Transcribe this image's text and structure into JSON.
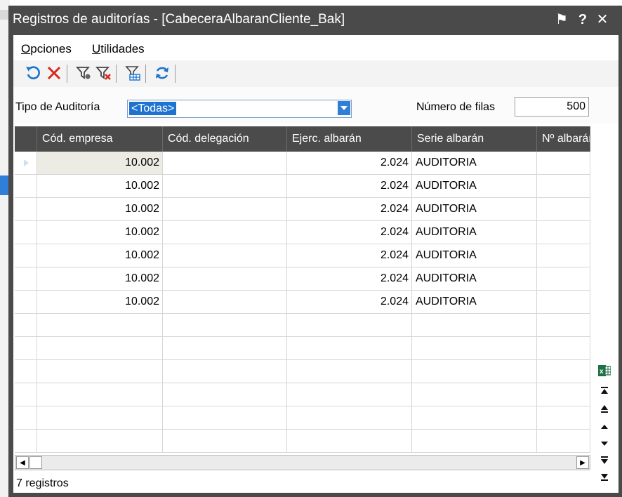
{
  "window": {
    "title": "Registros de auditorías - [CabeceraAlbaranCliente_Bak]",
    "pin_glyph": "⚑",
    "help_glyph": "?",
    "close_glyph": "✕"
  },
  "menu": {
    "items": [
      {
        "accel": "O",
        "rest": "pciones"
      },
      {
        "accel": "U",
        "rest": "tilidades"
      }
    ]
  },
  "toolbar": {
    "icons": [
      "undo-icon",
      "delete-icon",
      "filter-edit-icon",
      "filter-clear-icon",
      "filter-table-icon",
      "refresh-icon"
    ]
  },
  "filters": {
    "tipo_label": "Tipo de Auditoría",
    "tipo_value": "<Todas>",
    "filas_label": "Número de filas",
    "filas_value": "500"
  },
  "grid": {
    "columns": [
      "Cód. empresa",
      "Cód. delegación",
      "Ejerc. albarán",
      "Serie albarán",
      "Nº albarán"
    ],
    "rows": [
      {
        "empresa": "10.002",
        "delegacion": "",
        "ejercicio": "2.024",
        "serie": "AUDITORIA",
        "albaran": ""
      },
      {
        "empresa": "10.002",
        "delegacion": "",
        "ejercicio": "2.024",
        "serie": "AUDITORIA",
        "albaran": ""
      },
      {
        "empresa": "10.002",
        "delegacion": "",
        "ejercicio": "2.024",
        "serie": "AUDITORIA",
        "albaran": ""
      },
      {
        "empresa": "10.002",
        "delegacion": "",
        "ejercicio": "2.024",
        "serie": "AUDITORIA",
        "albaran": ""
      },
      {
        "empresa": "10.002",
        "delegacion": "",
        "ejercicio": "2.024",
        "serie": "AUDITORIA",
        "albaran": ""
      },
      {
        "empresa": "10.002",
        "delegacion": "",
        "ejercicio": "2.024",
        "serie": "AUDITORIA",
        "albaran": ""
      },
      {
        "empresa": "10.002",
        "delegacion": "",
        "ejercicio": "2.024",
        "serie": "AUDITORIA",
        "albaran": ""
      }
    ],
    "empty_rows": 6
  },
  "side_buttons": [
    "excel-export-icon",
    "first-record-icon",
    "previous-page-icon",
    "previous-record-icon",
    "next-record-icon",
    "next-page-icon",
    "last-record-icon"
  ],
  "status": "7 registros",
  "colors": {
    "title_bg": "#4a4a4a",
    "header_bg": "#4b4b4b",
    "selection": "#1e73d2",
    "active_cell": "#ecebe4"
  }
}
